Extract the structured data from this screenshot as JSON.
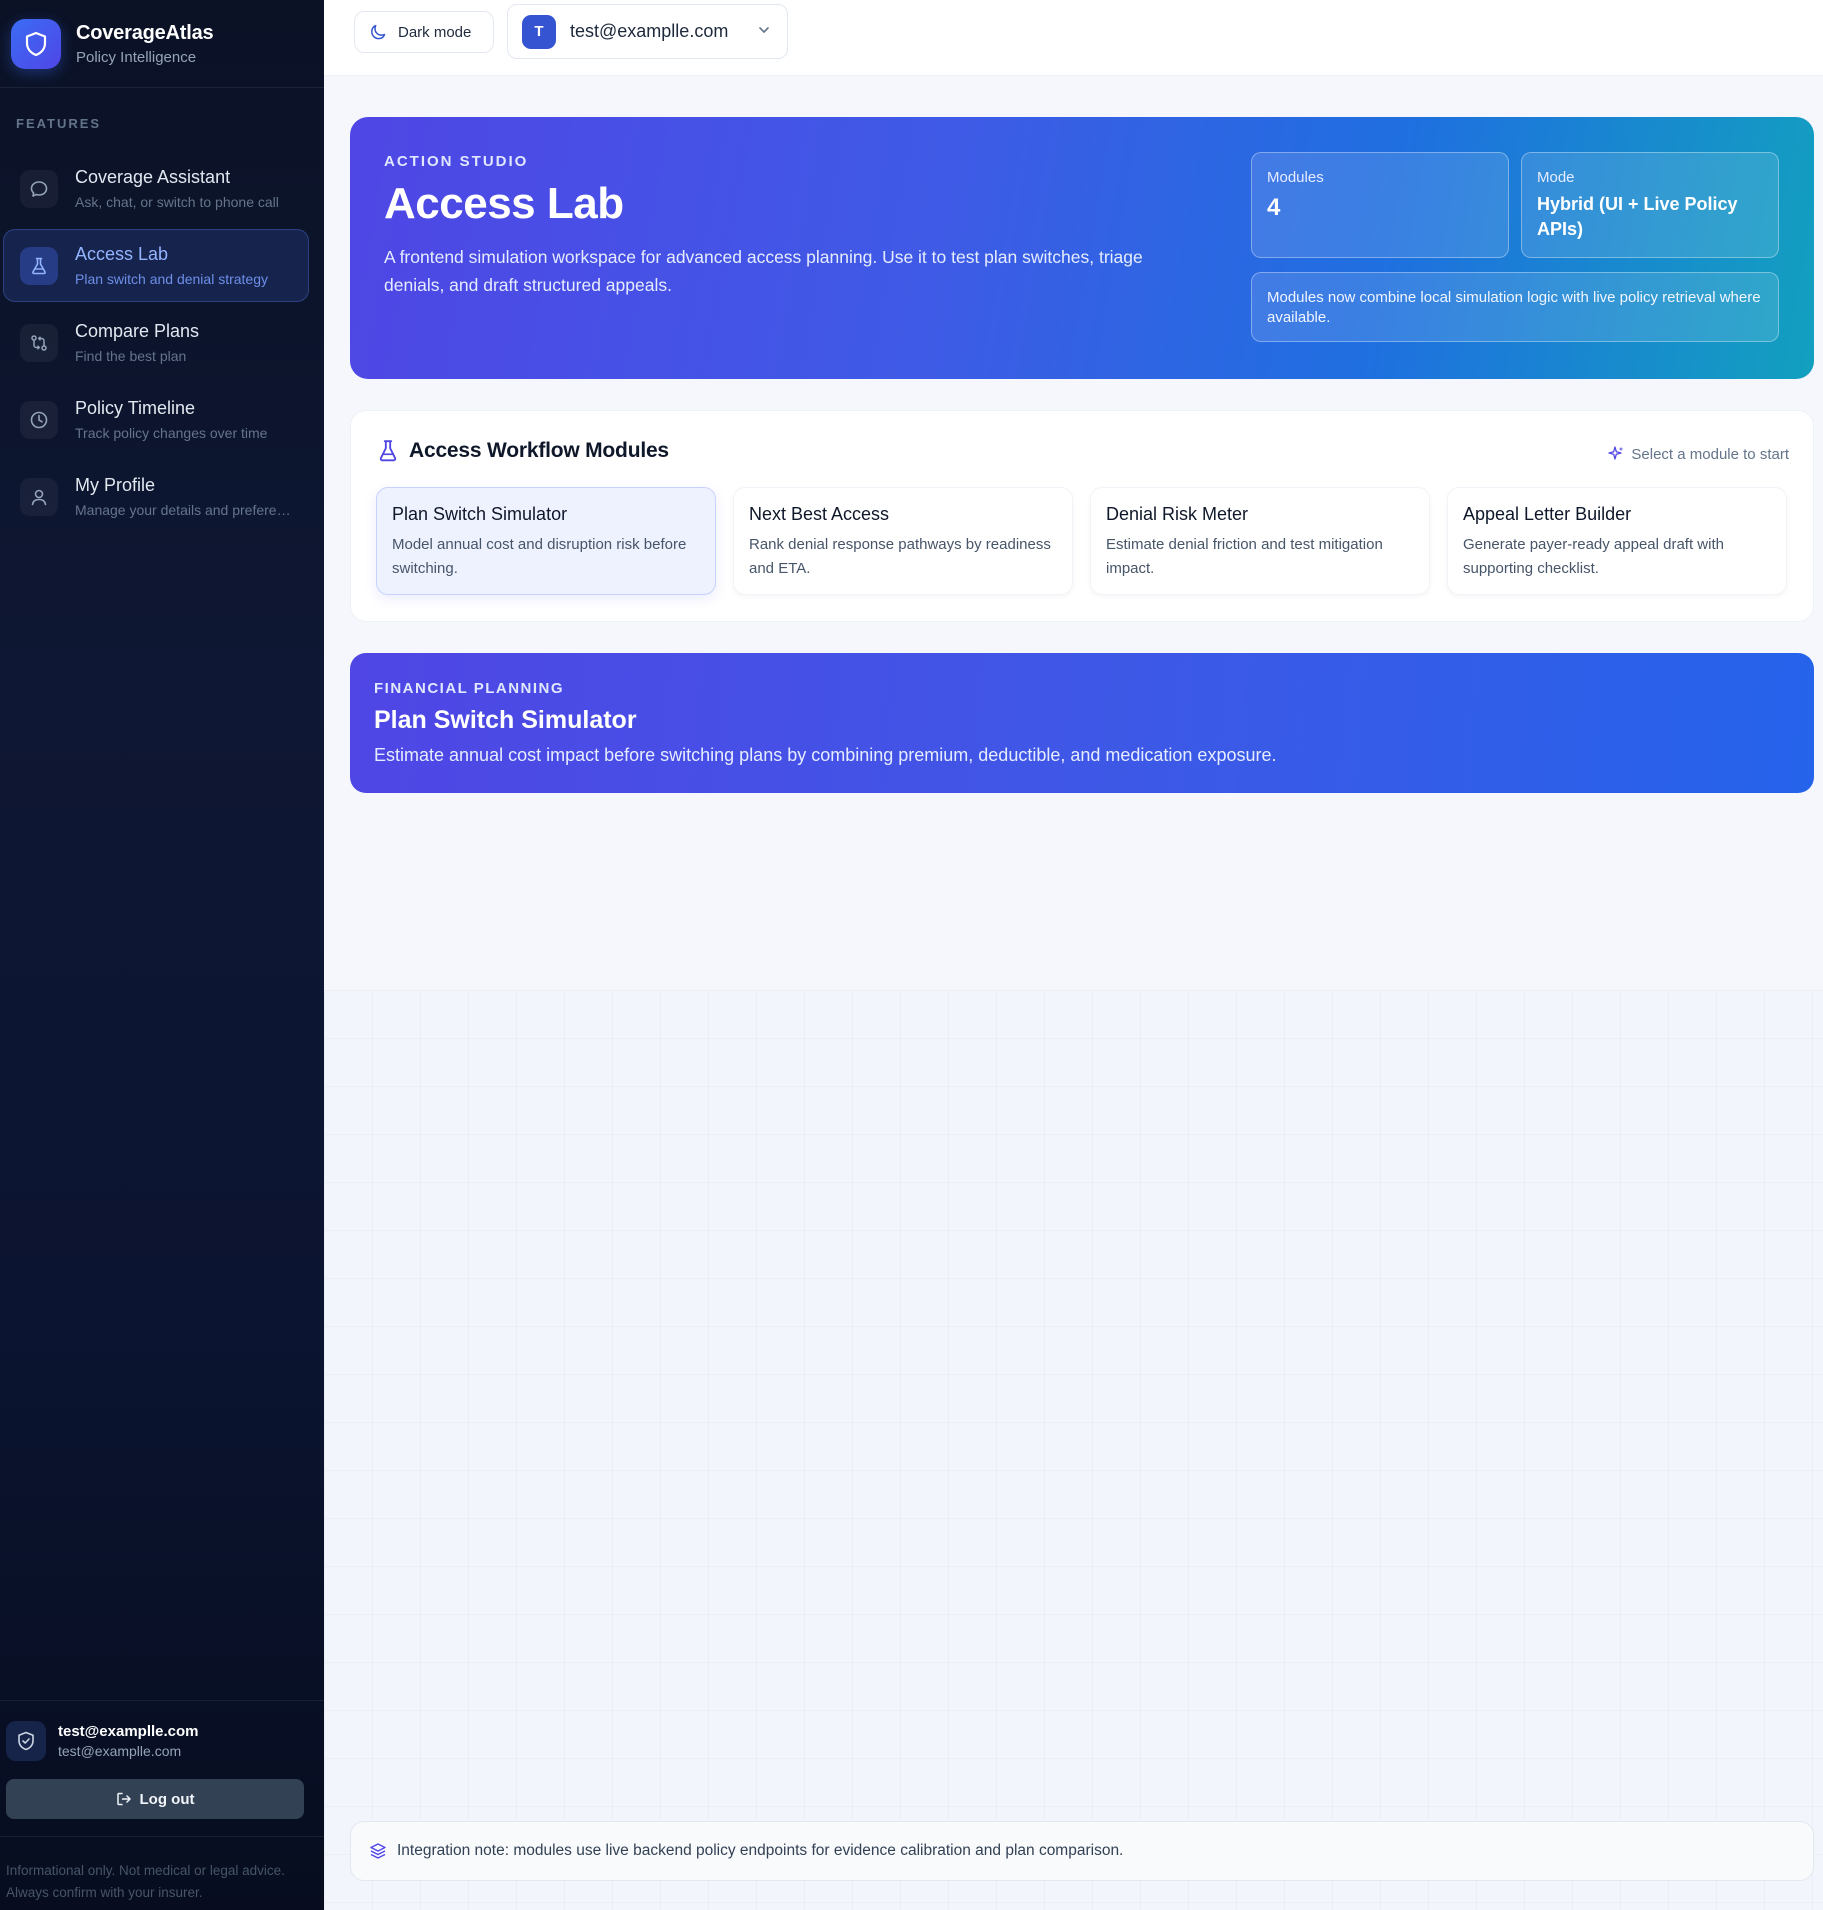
{
  "brand": {
    "name": "CoverageAtlas",
    "subtitle": "Policy Intelligence"
  },
  "sidebar": {
    "section_label": "FEATURES",
    "items": [
      {
        "title": "Coverage Assistant",
        "desc": "Ask, chat, or switch to phone call",
        "icon": "chat-bubble-icon",
        "active": false
      },
      {
        "title": "Access Lab",
        "desc": "Plan switch and denial strategy",
        "icon": "flask-icon",
        "active": true
      },
      {
        "title": "Compare Plans",
        "desc": "Find the best plan",
        "icon": "compare-arrows-icon",
        "active": false
      },
      {
        "title": "Policy Timeline",
        "desc": "Track policy changes over time",
        "icon": "clock-icon",
        "active": false
      },
      {
        "title": "My Profile",
        "desc": "Manage your details and preferences",
        "icon": "user-icon",
        "active": false
      }
    ],
    "user": {
      "name": "test@examplle.com",
      "email": "test@examplle.com"
    },
    "logout_label": "Log out",
    "disclaimer": "Informational only. Not medical or legal advice. Always confirm with your insurer."
  },
  "topbar": {
    "dark_mode_label": "Dark mode",
    "avatar_initial": "T",
    "account_email": "test@examplle.com"
  },
  "hero": {
    "eyebrow": "ACTION STUDIO",
    "title": "Access Lab",
    "description": "A frontend simulation workspace for advanced access planning. Use it to test plan switches, triage denials, and draft structured appeals.",
    "modules_label": "Modules",
    "modules_value": "4",
    "mode_label": "Mode",
    "mode_value": "Hybrid (UI + Live Policy APIs)",
    "note": "Modules now combine local simulation logic with live policy retrieval where available."
  },
  "modules_section": {
    "title": "Access Workflow Modules",
    "hint": "Select a module to start",
    "modules": [
      {
        "title": "Plan Switch Simulator",
        "desc": "Model annual cost and disruption risk before switching."
      },
      {
        "title": "Next Best Access",
        "desc": "Rank denial response pathways by readiness and ETA."
      },
      {
        "title": "Denial Risk Meter",
        "desc": "Estimate denial friction and test mitigation impact."
      },
      {
        "title": "Appeal Letter Builder",
        "desc": "Generate payer-ready appeal draft with supporting checklist."
      }
    ]
  },
  "financial": {
    "eyebrow": "FINANCIAL PLANNING",
    "title": "Plan Switch Simulator",
    "description": "Estimate annual cost impact before switching plans by combining premium, deductible, and medication exposure."
  },
  "integration_note": "Integration note: modules use live backend policy endpoints for evidence calibration and plan comparison.",
  "colors": {
    "accent": "#4f46e5",
    "accent_blue": "#2563eb",
    "teal": "#12a0bf",
    "sidebar_bg": "#0b1226"
  }
}
